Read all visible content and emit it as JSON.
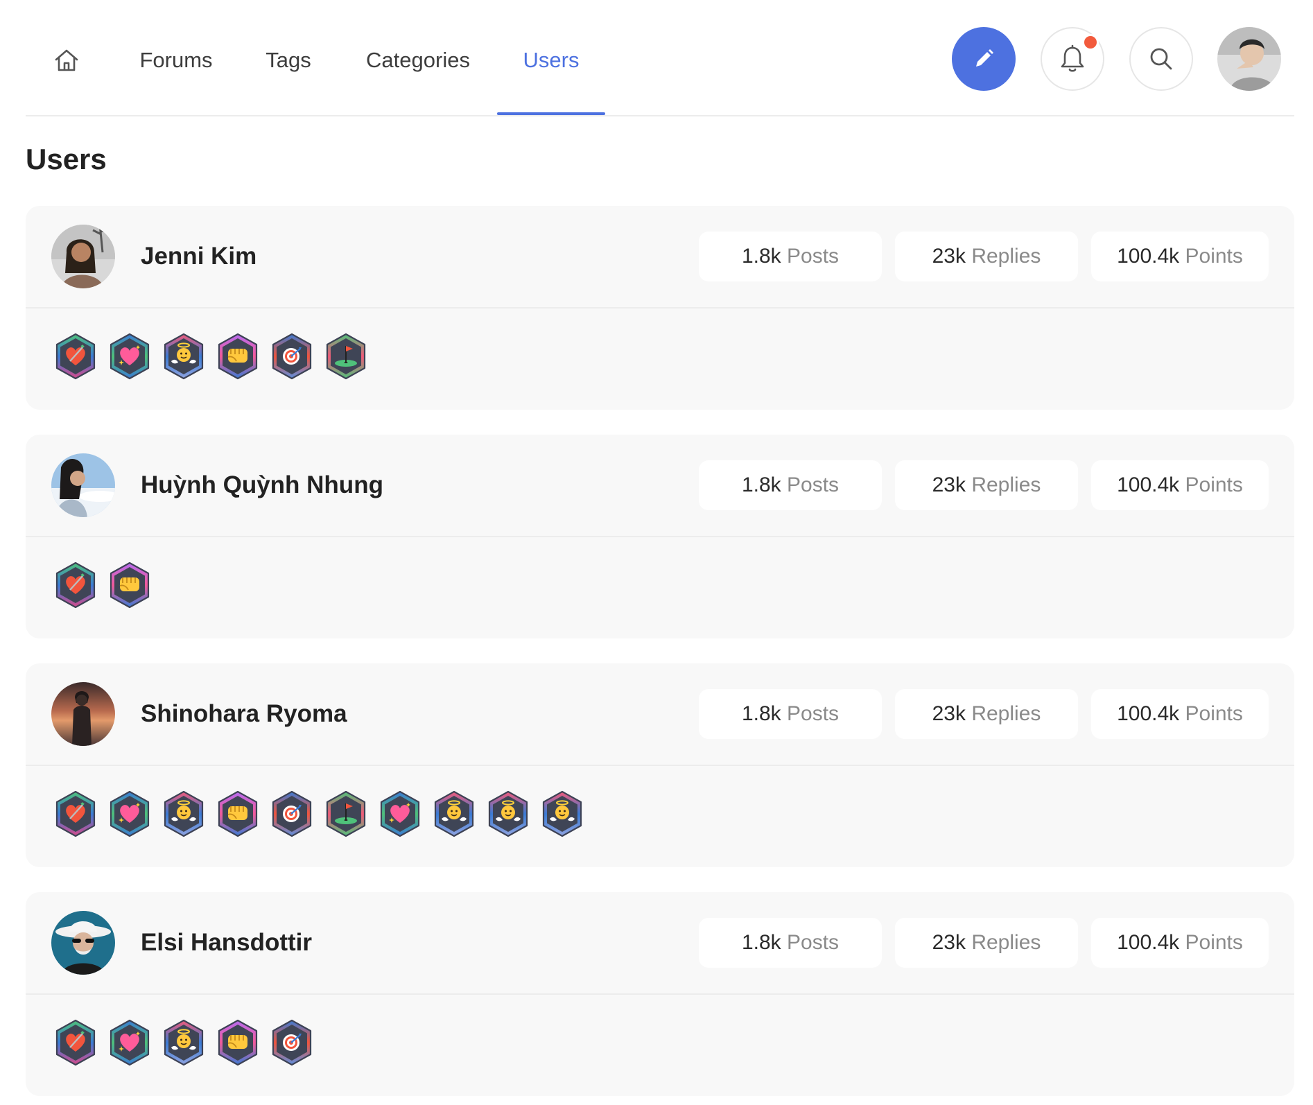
{
  "nav": {
    "items": [
      {
        "label": "Forums",
        "active": false
      },
      {
        "label": "Tags",
        "active": false
      },
      {
        "label": "Categories",
        "active": false
      },
      {
        "label": "Users",
        "active": true
      }
    ],
    "accent_color": "#4d71e0",
    "notification_dot_color": "#f25a3c",
    "icons": {
      "home": "home-icon",
      "compose": "pencil-icon",
      "notifications": "bell-icon",
      "search": "search-icon"
    }
  },
  "page": {
    "title": "Users"
  },
  "users": [
    {
      "name": "Jenni Kim",
      "stats": {
        "posts_value": "1.8k",
        "posts_label": "Posts",
        "replies_value": "23k",
        "replies_label": "Replies",
        "points_value": "100.4k",
        "points_label": "Points"
      },
      "badges": [
        "heart-arrow",
        "sparkle-heart",
        "angel",
        "fist",
        "target",
        "golf-flag"
      ]
    },
    {
      "name": "Huỳnh Quỳnh Nhung",
      "stats": {
        "posts_value": "1.8k",
        "posts_label": "Posts",
        "replies_value": "23k",
        "replies_label": "Replies",
        "points_value": "100.4k",
        "points_label": "Points"
      },
      "badges": [
        "heart-arrow",
        "fist"
      ]
    },
    {
      "name": "Shinohara Ryoma",
      "stats": {
        "posts_value": "1.8k",
        "posts_label": "Posts",
        "replies_value": "23k",
        "replies_label": "Replies",
        "points_value": "100.4k",
        "points_label": "Points"
      },
      "badges": [
        "heart-arrow",
        "sparkle-heart",
        "angel",
        "fist",
        "target",
        "golf-flag",
        "sparkle-heart",
        "angel",
        "angel",
        "angel"
      ]
    },
    {
      "name": "Elsi Hansdottir",
      "stats": {
        "posts_value": "1.8k",
        "posts_label": "Posts",
        "replies_value": "23k",
        "replies_label": "Replies",
        "points_value": "100.4k",
        "points_label": "Points"
      },
      "badges": [
        "heart-arrow",
        "sparkle-heart",
        "angel",
        "fist",
        "target"
      ]
    }
  ]
}
